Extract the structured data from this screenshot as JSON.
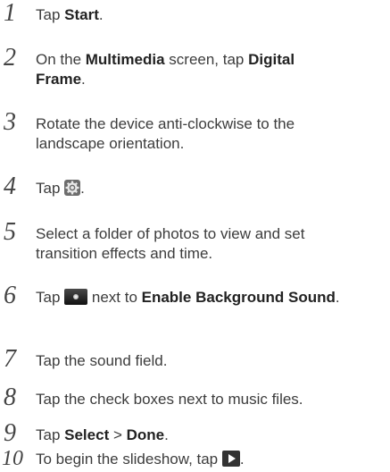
{
  "steps": [
    {
      "num": "1",
      "a": "Tap ",
      "b": "Start",
      "c": "."
    },
    {
      "num": "2",
      "a": "On the ",
      "b": "Multimedia",
      "c": " screen, tap ",
      "d": "Digital Frame",
      "e": "."
    },
    {
      "num": "3",
      "a": "Rotate the device anti-clockwise to the landscape orientation."
    },
    {
      "num": "4",
      "a": "Tap ",
      "icon": "settings-gear-icon",
      "c": "."
    },
    {
      "num": "5",
      "a": "Select a folder of photos to view and set transition effects and time."
    },
    {
      "num": "6",
      "a": "Tap ",
      "icon": "sound-toggle-icon",
      "c": " next to ",
      "d": "Enable Background Sound",
      "e": "."
    },
    {
      "num": "7",
      "a": "Tap the sound field."
    },
    {
      "num": "8",
      "a": "Tap the check boxes next to music files."
    },
    {
      "num": "9",
      "a": "Tap ",
      "b": "Select",
      "c": " > ",
      "d": "Done",
      "e": "."
    },
    {
      "num": "10",
      "a": "To begin the slideshow, tap ",
      "icon": "play-icon",
      "c": "."
    }
  ]
}
